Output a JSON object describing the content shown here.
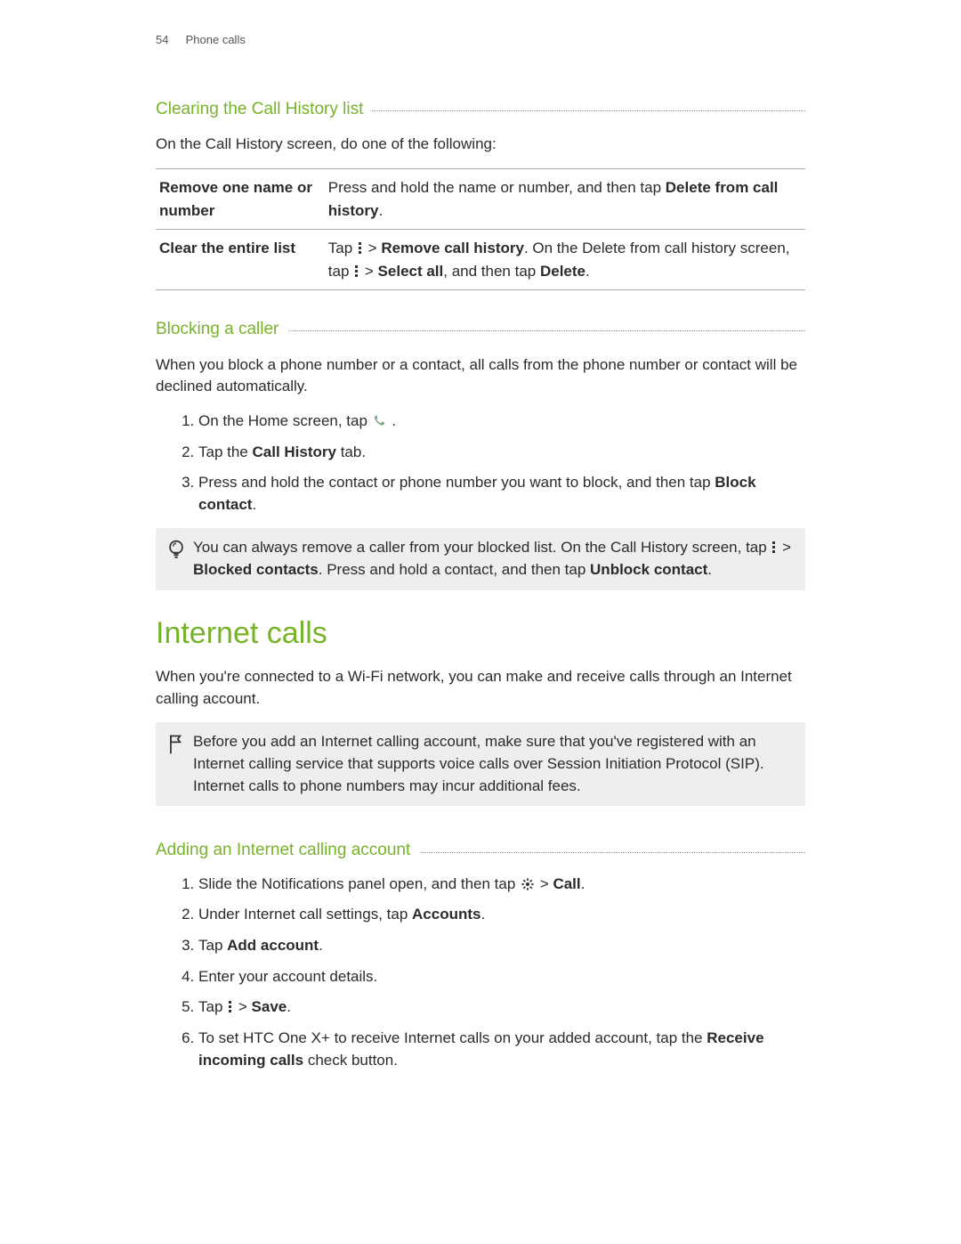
{
  "header": {
    "page_number": "54",
    "section": "Phone calls"
  },
  "section1": {
    "heading": "Clearing the Call History list",
    "intro": "On the Call History screen, do one of the following:",
    "table": {
      "row1_label": "Remove one name or number",
      "row1_value_a": "Press and hold the name or number, and then tap ",
      "row1_value_b": "Delete from call history",
      "row1_value_c": ".",
      "row2_label": "Clear the entire list",
      "row2_a": "Tap ",
      "row2_b": " > ",
      "row2_c": "Remove call history",
      "row2_d": ". On the Delete from call history screen, tap ",
      "row2_e": " > ",
      "row2_f": "Select all",
      "row2_g": ", and then tap ",
      "row2_h": "Delete",
      "row2_i": "."
    }
  },
  "section2": {
    "heading": "Blocking a caller",
    "intro": "When you block a phone number or a contact, all calls from the phone number or contact will be declined automatically.",
    "steps": {
      "s1": "On the Home screen, tap ",
      "s1b": ".",
      "s2a": "Tap the ",
      "s2b": "Call History",
      "s2c": " tab.",
      "s3a": "Press and hold the contact or phone number you want to block, and then tap ",
      "s3b": "Block contact",
      "s3c": "."
    },
    "tip": {
      "a": "You can always remove a caller from your blocked list. On the Call History screen, tap ",
      "b": " > ",
      "c": "Blocked contacts",
      "d": ". Press and hold a contact, and then tap ",
      "e": "Unblock contact",
      "f": "."
    }
  },
  "bigHeading": "Internet calls",
  "internetIntro": "When you're connected to a Wi-Fi network, you can make and receive calls through an Internet calling account.",
  "important": "Before you add an Internet calling account, make sure that you've registered with an Internet calling service that supports voice calls over Session Initiation Protocol (SIP). Internet calls to phone numbers may incur additional fees.",
  "section3": {
    "heading": "Adding an Internet calling account",
    "steps": {
      "s1a": "Slide the Notifications panel open, and then tap ",
      "s1b": " > ",
      "s1c": "Call",
      "s1d": ".",
      "s2a": "Under Internet call settings, tap ",
      "s2b": "Accounts",
      "s2c": ".",
      "s3a": "Tap ",
      "s3b": "Add account",
      "s3c": ".",
      "s4": "Enter your account details.",
      "s5a": "Tap ",
      "s5b": " > ",
      "s5c": "Save",
      "s5d": ".",
      "s6a": "To set HTC One X+ to receive Internet calls on your added account, tap the ",
      "s6b": "Receive incoming calls",
      "s6c": " check button."
    }
  }
}
